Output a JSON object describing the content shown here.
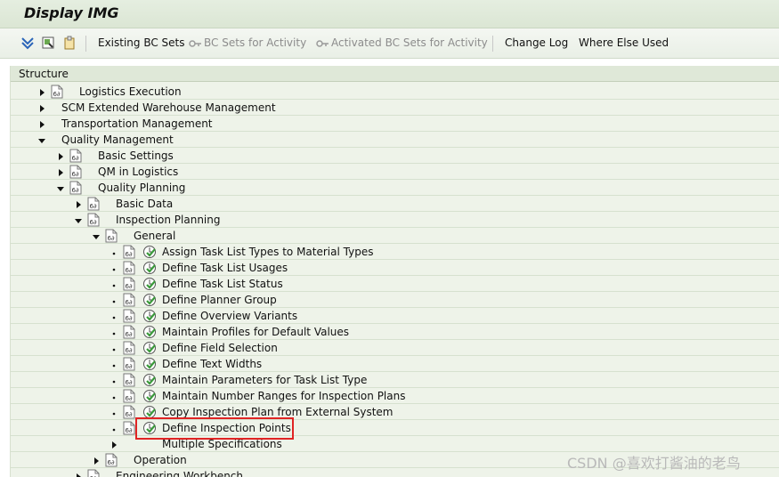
{
  "window": {
    "title": "Display IMG"
  },
  "toolbar": {
    "icons": [
      "expand-all-icon",
      "find-icon",
      "clipboard-icon"
    ],
    "buttons": [
      {
        "label": "Existing BC Sets",
        "enabled": true
      },
      {
        "label": "BC Sets for Activity",
        "enabled": false,
        "icon": "bc-set-icon"
      },
      {
        "label": "Activated BC Sets for Activity",
        "enabled": false,
        "icon": "bc-set-icon"
      },
      {
        "label": "Change Log",
        "enabled": true
      },
      {
        "label": "Where Else Used",
        "enabled": true
      }
    ]
  },
  "structure": {
    "header": "Structure",
    "rows": [
      {
        "label": "Logistics Execution",
        "level": 0,
        "state": "collapsed",
        "exec": false
      },
      {
        "label": "SCM Extended Warehouse Management",
        "level": 0,
        "state": "collapsed",
        "exec": false,
        "icon": false
      },
      {
        "label": "Transportation Management",
        "level": 0,
        "state": "collapsed",
        "exec": false,
        "icon": false
      },
      {
        "label": "Quality Management",
        "level": 0,
        "state": "expanded",
        "exec": false,
        "icon": false
      },
      {
        "label": "Basic Settings",
        "level": 1,
        "state": "collapsed",
        "exec": false
      },
      {
        "label": "QM in Logistics",
        "level": 1,
        "state": "collapsed",
        "exec": false
      },
      {
        "label": "Quality Planning",
        "level": 1,
        "state": "expanded",
        "exec": false
      },
      {
        "label": "Basic Data",
        "level": 2,
        "state": "collapsed",
        "exec": false
      },
      {
        "label": "Inspection Planning",
        "level": 2,
        "state": "expanded",
        "exec": false
      },
      {
        "label": "General",
        "level": 3,
        "state": "expanded",
        "exec": false
      },
      {
        "label": "Assign Task List Types to Material Types",
        "level": 4,
        "state": "leaf",
        "exec": true
      },
      {
        "label": "Define Task List Usages",
        "level": 4,
        "state": "leaf",
        "exec": true
      },
      {
        "label": "Define Task List Status",
        "level": 4,
        "state": "leaf",
        "exec": true
      },
      {
        "label": "Define Planner Group",
        "level": 4,
        "state": "leaf",
        "exec": true
      },
      {
        "label": "Define Overview Variants",
        "level": 4,
        "state": "leaf",
        "exec": true
      },
      {
        "label": "Maintain Profiles for Default Values",
        "level": 4,
        "state": "leaf",
        "exec": true
      },
      {
        "label": "Define Field Selection",
        "level": 4,
        "state": "leaf",
        "exec": true
      },
      {
        "label": "Define Text Widths",
        "level": 4,
        "state": "leaf",
        "exec": true
      },
      {
        "label": "Maintain Parameters for Task List Type",
        "level": 4,
        "state": "leaf",
        "exec": true
      },
      {
        "label": "Maintain Number Ranges for Inspection Plans",
        "level": 4,
        "state": "leaf",
        "exec": true
      },
      {
        "label": "Copy Inspection Plan from External System",
        "level": 4,
        "state": "leaf",
        "exec": true
      },
      {
        "label": "Define Inspection Points",
        "level": 4,
        "state": "leaf",
        "exec": true,
        "highlighted": true
      },
      {
        "label": "Multiple Specifications",
        "level": 4,
        "state": "collapsed",
        "exec": false,
        "icon": false
      },
      {
        "label": "Operation",
        "level": 3,
        "state": "collapsed",
        "exec": false
      },
      {
        "label": "Engineering Workbench",
        "level": 2,
        "state": "collapsed",
        "exec": false
      }
    ]
  },
  "watermark": "CSDN @喜欢打酱油的老鸟",
  "colors": {
    "panel_bg": "#eef3e9",
    "highlight": "#e02424",
    "exec_green": "#3a9a3a"
  }
}
